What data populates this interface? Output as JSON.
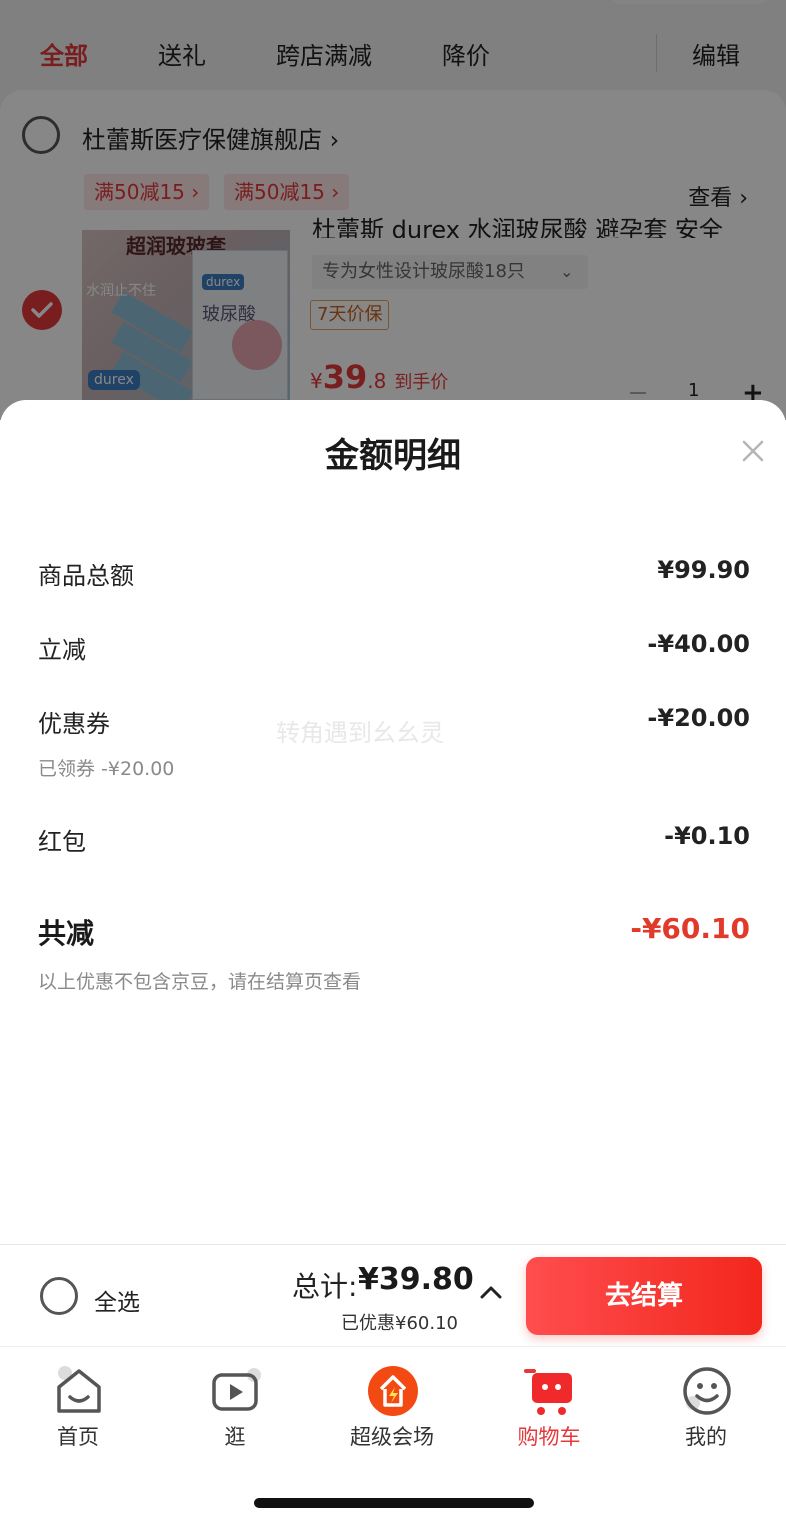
{
  "tabs": {
    "all": "全部",
    "gift": "送礼",
    "cross_store": "跨店满减",
    "price_drop": "降价",
    "edit": "编辑"
  },
  "store": {
    "name": "杜蕾斯医疗保健旗舰店 ›",
    "promos": [
      "满50减15 ›",
      "满50减15 ›"
    ],
    "view_more": "查看 ›"
  },
  "product": {
    "title": "杜蕾斯 durex 水润玻尿酸 避孕套 安全",
    "spec": "专为女性设计玻尿酸18只",
    "guarantee": "7天价保",
    "price_currency": "¥",
    "price_int": "39",
    "price_dec": ".8",
    "price_suffix": "到手价",
    "quantity": "1",
    "image_banner": "超润玻玻套",
    "image_side_text": "水润止不住",
    "image_box_text": "玻尿酸",
    "image_brand": "durex"
  },
  "sheet": {
    "title": "金额明细",
    "rows": [
      {
        "label": "商品总额",
        "value": "¥99.90"
      },
      {
        "label": "立减",
        "value": "-¥40.00"
      },
      {
        "label": "优惠券",
        "value": "-¥20.00",
        "sub": "已领券 -¥20.00"
      },
      {
        "label": "红包",
        "value": "-¥0.10"
      }
    ],
    "total_label": "共减",
    "total_value": "-¥60.10",
    "note": "以上优惠不包含京豆，请在结算页查看",
    "watermark": "转角遇到幺幺灵"
  },
  "checkout": {
    "select_all": "全选",
    "total_label": "总计:",
    "total_value": "¥39.80",
    "saved": "已优惠¥60.10",
    "button": "去结算"
  },
  "tabbar": {
    "items": [
      {
        "label": "首页",
        "icon": "home-icon"
      },
      {
        "label": "逛",
        "icon": "video-play-icon"
      },
      {
        "label": "超级会场",
        "icon": "super-venue-icon"
      },
      {
        "label": "购物车",
        "icon": "cart-icon",
        "active": true
      },
      {
        "label": "我的",
        "icon": "profile-smile-icon"
      }
    ]
  },
  "colors": {
    "accent": "#e4393c",
    "total_red": "#e23a2a",
    "checkout_button": "#f2271c"
  }
}
